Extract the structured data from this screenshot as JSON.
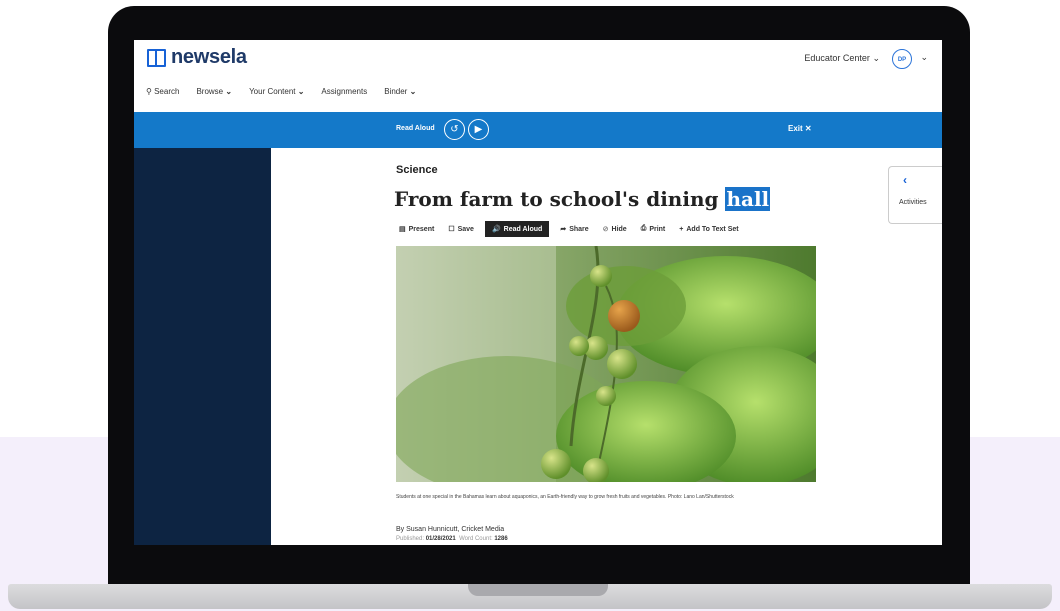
{
  "app": {
    "logo_text": "newsela",
    "educator_center": "Educator Center",
    "avatar_initials": "DP",
    "accent_color": "#1479c9",
    "sidebar_color": "#0d2442"
  },
  "nav": {
    "search": "Search",
    "browse": "Browse",
    "your_content": "Your Content",
    "assignments": "Assignments",
    "binder": "Binder"
  },
  "read_aloud_bar": {
    "label": "Read Aloud",
    "exit": "Exit"
  },
  "article": {
    "section": "Science",
    "title_main": "From farm to school's dining ",
    "title_highlight": "hall",
    "caption": "Students at one special in the Bahamas learn about aquaponics, an Earth-friendly way to grow fresh fruits and vegetables. Photo: Lano Lan/Shutterstock",
    "byline": "By Susan Hunnicutt, Cricket Media",
    "published_label": "Published:",
    "published_date": "01/28/2021",
    "word_count_label": "Word Count:",
    "word_count": "1286"
  },
  "toolbar": {
    "present": "Present",
    "save": "Save",
    "read_aloud": "Read Aloud",
    "share": "Share",
    "hide": "Hide",
    "print": "Print",
    "add_to_text_set": "Add To Text Set"
  },
  "activities": {
    "label": "Activities"
  }
}
